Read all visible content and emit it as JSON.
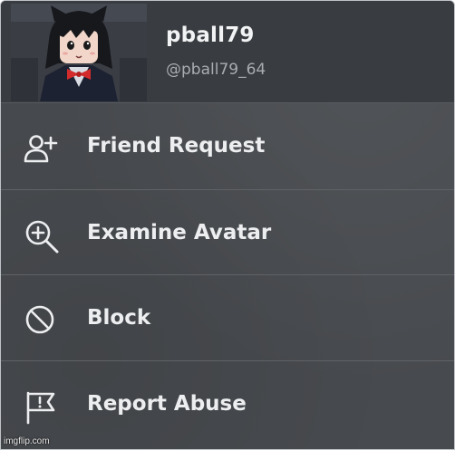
{
  "profile": {
    "display_name": "pball79",
    "username": "@pball79_64"
  },
  "menu": {
    "items": [
      {
        "label": "Friend Request",
        "icon": "add-friend-icon"
      },
      {
        "label": "Examine Avatar",
        "icon": "magnify-plus-icon"
      },
      {
        "label": "Block",
        "icon": "block-icon"
      },
      {
        "label": "Report Abuse",
        "icon": "flag-icon"
      }
    ]
  },
  "watermark": "imgflip.com",
  "colors": {
    "panel": "#474a4e",
    "header": "#393c40",
    "text": "#eceef0",
    "subtext": "#a9adb2"
  }
}
